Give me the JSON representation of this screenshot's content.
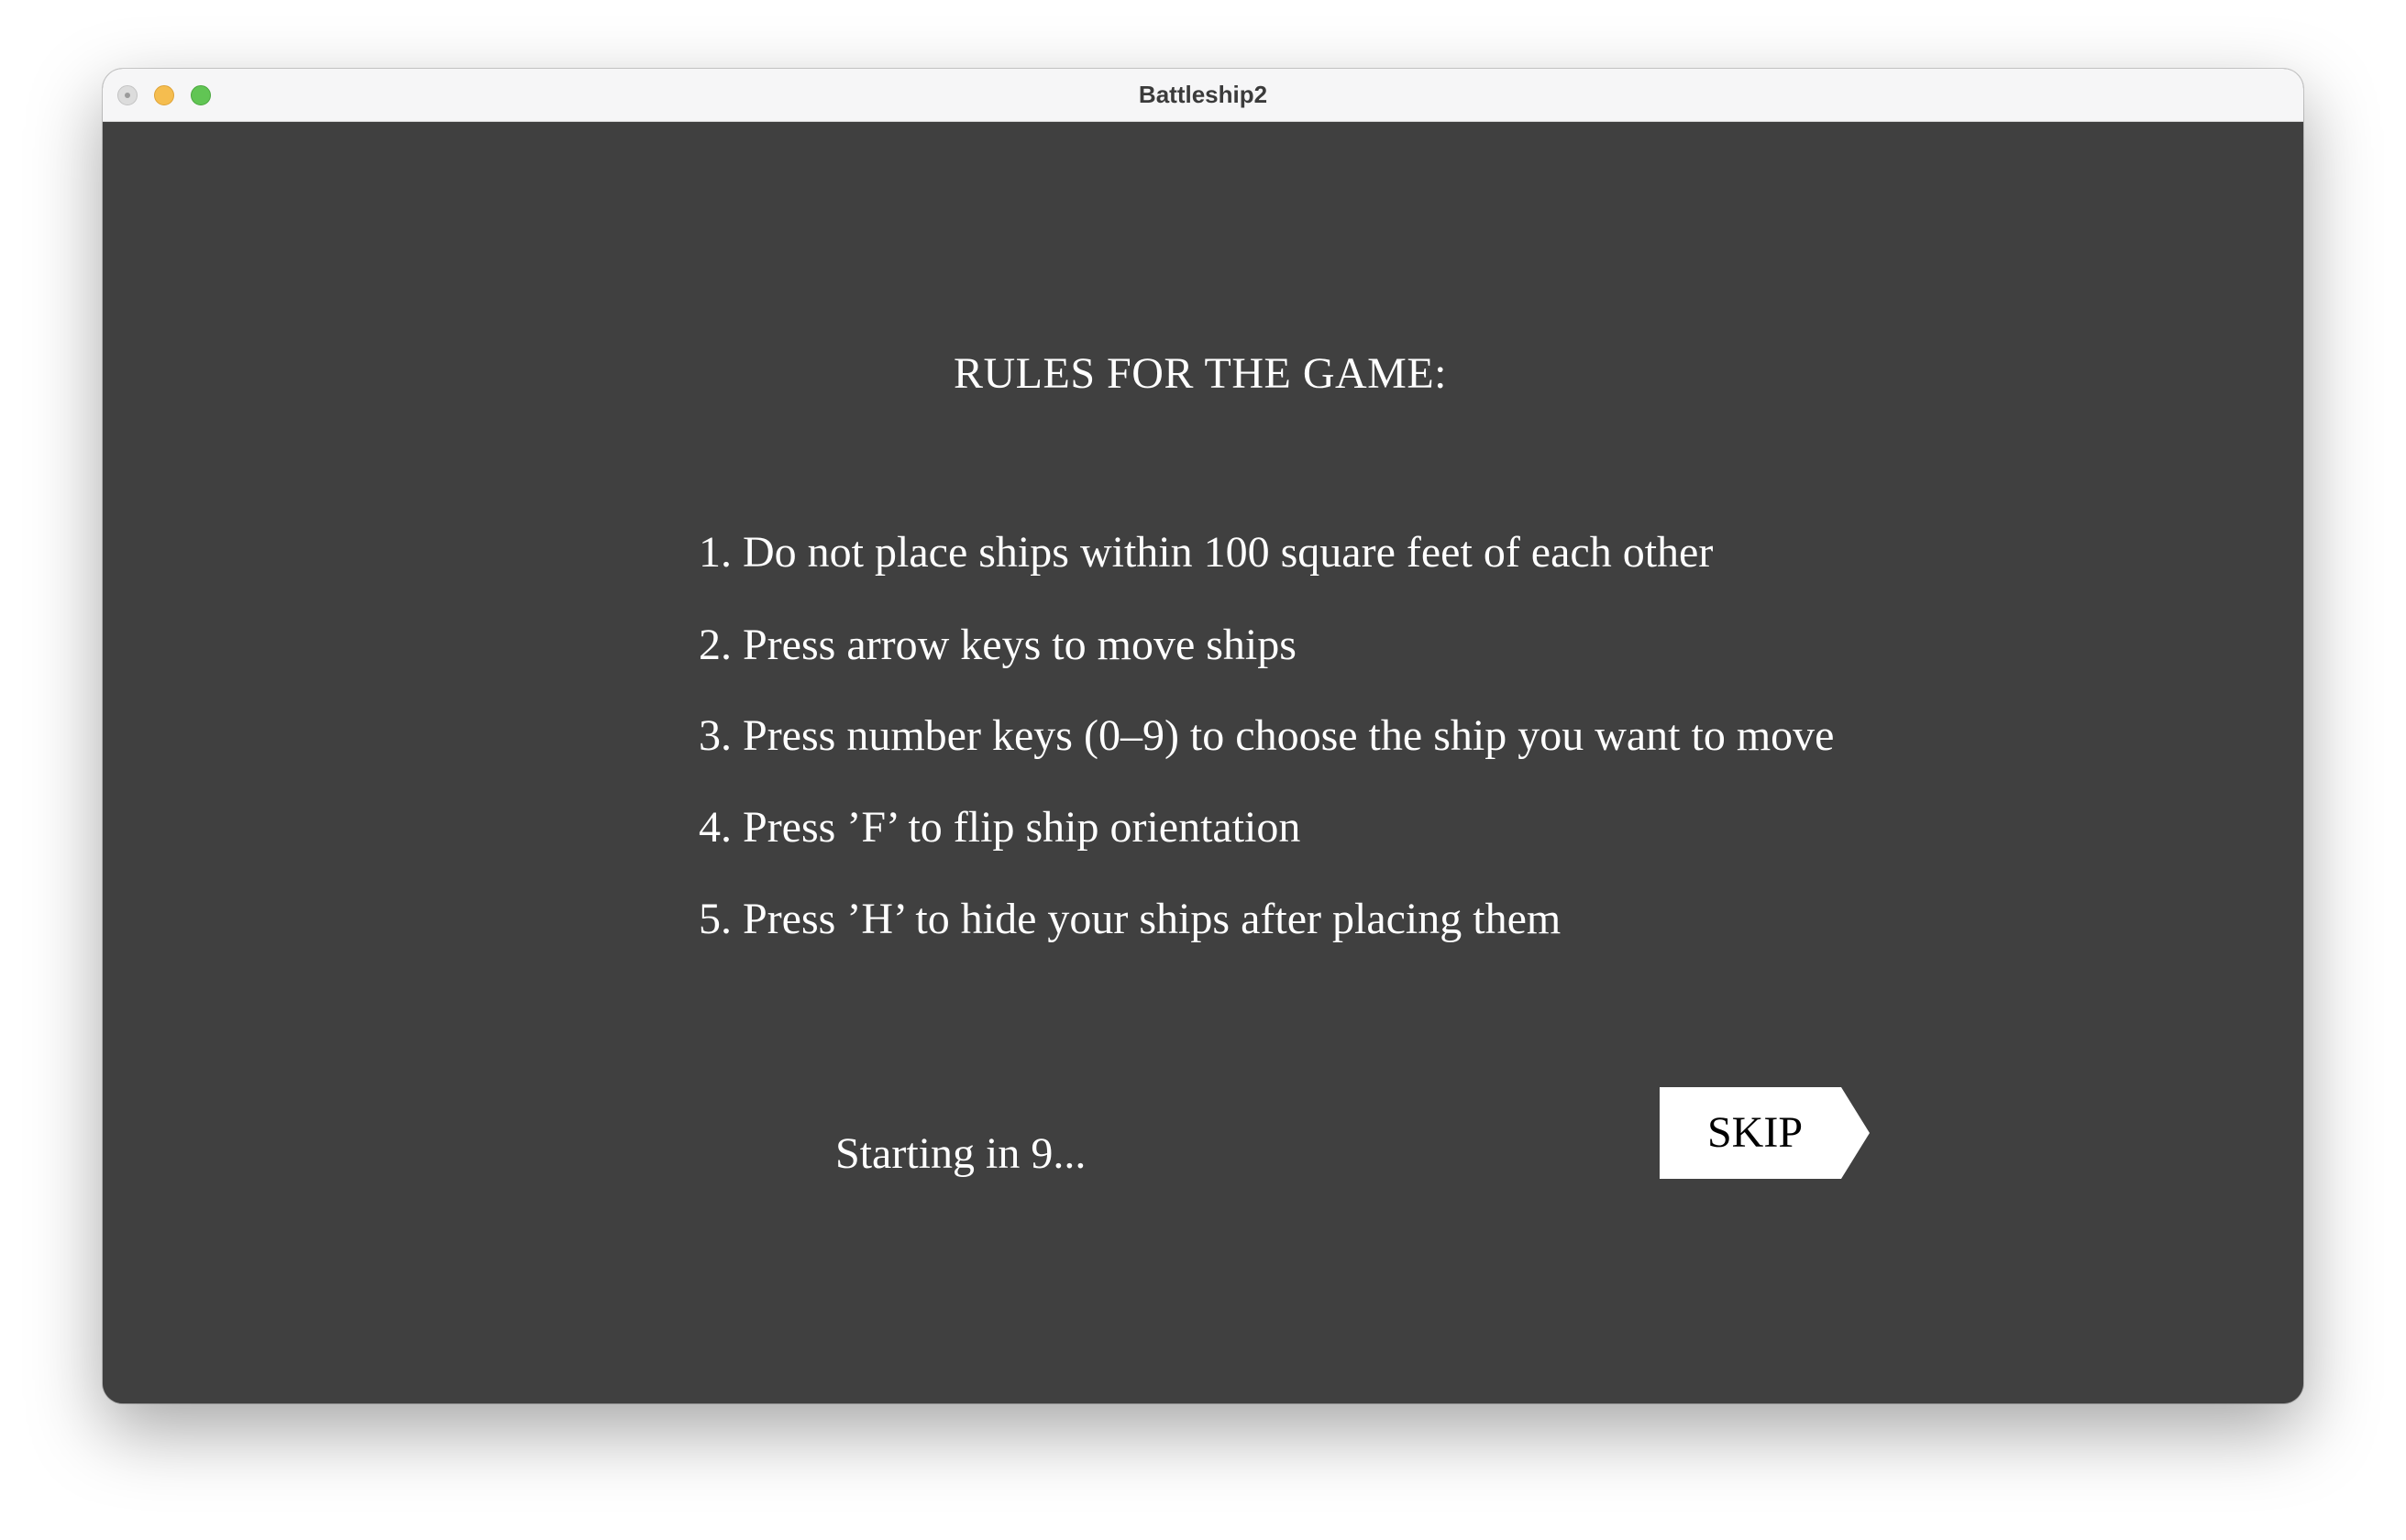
{
  "window": {
    "title": "Battleship2",
    "background_color": "#404040"
  },
  "rules": {
    "heading": "RULES FOR THE GAME:",
    "items": [
      "1. Do not place ships within 100 square feet of each other",
      "2. Press arrow keys to move ships",
      "3. Press number keys (0–9) to choose the ship you want to move",
      "4. Press ’F’ to flip ship orientation",
      "5. Press ’H’ to hide your ships after placing them"
    ]
  },
  "countdown": {
    "text": "Starting in 9..."
  },
  "skip_button": {
    "label": "SKIP",
    "shape": "arrow-pentagon",
    "fill_color": "#ffffff",
    "text_color": "#000000"
  },
  "traffic_lights": {
    "close_color": "#dcdcdc",
    "minimize_color": "#f5bd4f",
    "zoom_color": "#61c554"
  }
}
